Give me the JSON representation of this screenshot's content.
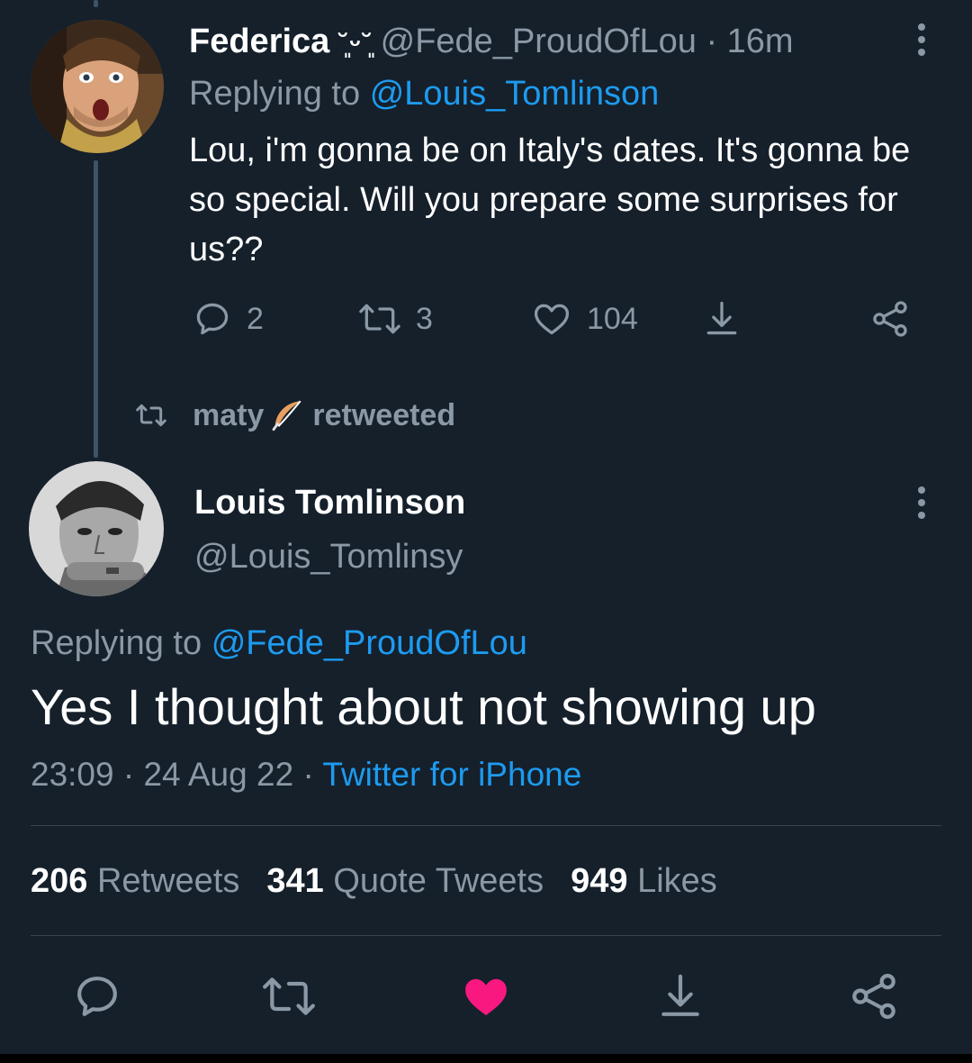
{
  "parent_tweet": {
    "author_name": "Federica",
    "author_name_emoji": "˘͈ᵕ˘͈",
    "handle": "@Fede_ProudOfLou",
    "separator": "·",
    "time": "16m",
    "replying_prefix": "Replying to",
    "replying_to": "@Louis_Tomlinson",
    "text": "Lou, i'm gonna be on Italy's dates. It's gonna be so special. Will you prepare some surprises for us??",
    "actions": {
      "replies": "2",
      "retweets": "3",
      "likes": "104"
    },
    "more_icon": "more-vertical-icon"
  },
  "retweet_context": {
    "user": "maty",
    "emoji": "feather-emoji",
    "suffix": "retweeted"
  },
  "main_tweet": {
    "author_name": "Louis Tomlinson",
    "handle": "@Louis_Tomlinsy",
    "replying_prefix": "Replying to",
    "replying_to": "@Fede_ProudOfLou",
    "text": "Yes I thought about not showing up",
    "time": "23:09",
    "separator": "·",
    "date": "24 Aug 22",
    "source": "Twitter for iPhone",
    "stats": {
      "retweets": "206",
      "retweets_label": "Retweets",
      "quotes": "341",
      "quotes_label": "Quote Tweets",
      "likes": "949",
      "likes_label": "Likes"
    },
    "liked": true,
    "more_icon": "more-vertical-icon"
  },
  "colors": {
    "background": "#15202b",
    "text_secondary": "#8b98a5",
    "link_blue": "#1d9bf0",
    "like_pink": "#f91880",
    "divider": "#38444d"
  }
}
